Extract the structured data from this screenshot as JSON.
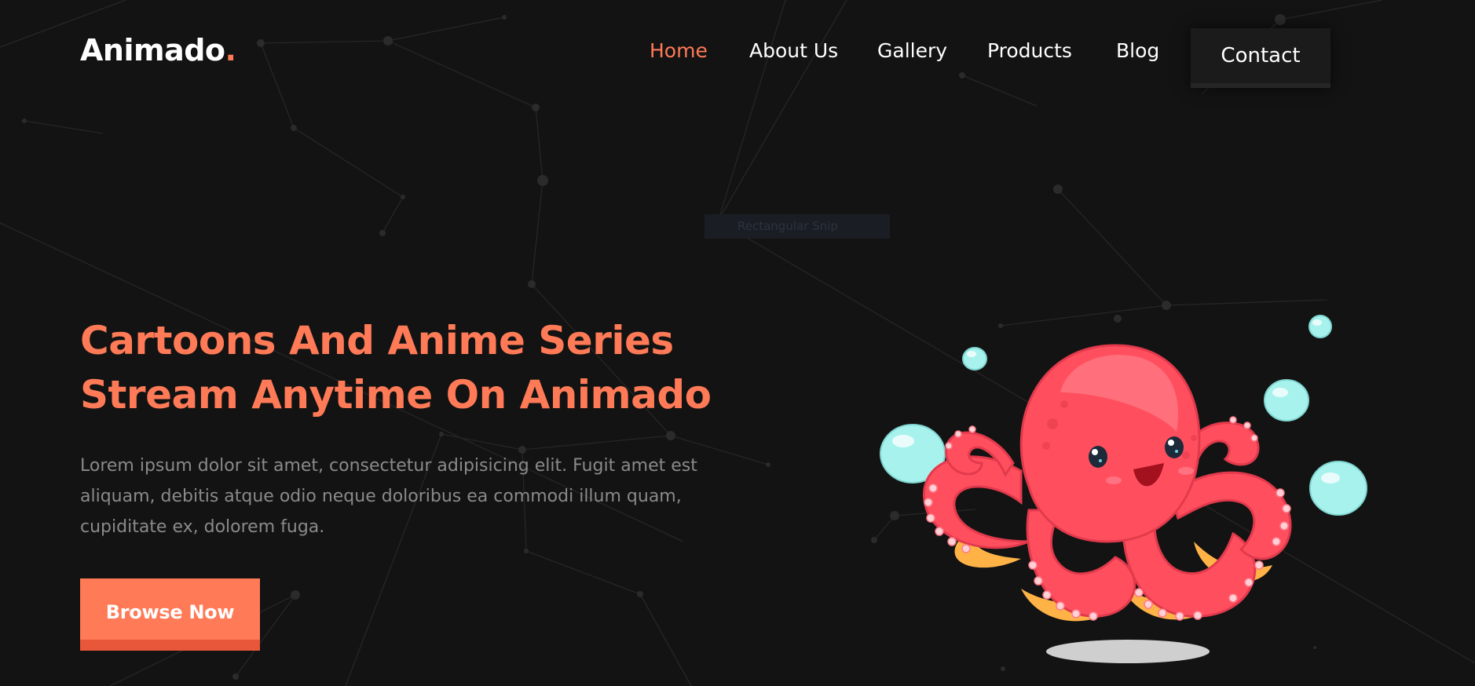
{
  "brand": {
    "name": "Animado",
    "dot": ".",
    "accent_color": "#ff7a57",
    "background_color": "#131313"
  },
  "nav": {
    "items": [
      {
        "label": "Home",
        "active": true
      },
      {
        "label": "About Us",
        "active": false
      },
      {
        "label": "Gallery",
        "active": false
      },
      {
        "label": "Products",
        "active": false
      },
      {
        "label": "Blog",
        "active": false
      }
    ],
    "contact_label": "Contact"
  },
  "overlay": {
    "snip_label": "Rectangular Snip"
  },
  "hero": {
    "title_line1": "Cartoons And Anime Series",
    "title_line2": "Stream Anytime On Animado",
    "description": "Lorem ipsum dolor sit amet, consectetur adipisicing elit. Fugit amet est aliquam, debitis atque odio neque doloribus ea commodi illum quam, cupiditate ex, dolorem fuga.",
    "cta_label": "Browse Now"
  },
  "illustration": {
    "icon": "octopus-illustration",
    "body_color": "#ff4f5f",
    "bubble_color": "#a8f2ee"
  }
}
